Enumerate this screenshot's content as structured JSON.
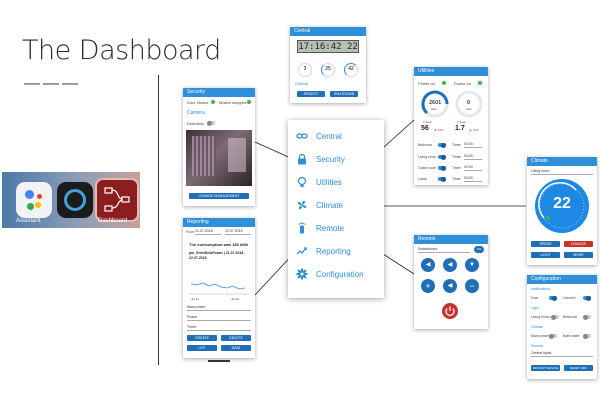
{
  "page": {
    "title": "The Dashboard",
    "dashes": "———"
  },
  "dock": {
    "apps": [
      {
        "label": "Assistant",
        "icon": "google-assistant-icon"
      },
      {
        "label": "",
        "icon": "alexa-ring-icon"
      },
      {
        "label": "Dashboard",
        "icon": "node-red-flow-icon"
      }
    ]
  },
  "menu": {
    "items": [
      {
        "label": "Central",
        "icon": "link-icon"
      },
      {
        "label": "Security",
        "icon": "lock-icon"
      },
      {
        "label": "Utilities",
        "icon": "lightbulb-icon"
      },
      {
        "label": "Climate",
        "icon": "fan-icon"
      },
      {
        "label": "Remote",
        "icon": "remote-icon"
      },
      {
        "label": "Reporting",
        "icon": "trending-icon"
      },
      {
        "label": "Configuration",
        "icon": "gear-icon"
      }
    ],
    "accent": "#2f8fd8"
  },
  "central": {
    "header": "Central",
    "clock": "17:16:42 22",
    "gauges": [
      "3",
      "25",
      "42"
    ],
    "link": "Central",
    "buttons": [
      "REBOOT",
      "SHUTDOWN"
    ]
  },
  "security": {
    "header": "Security",
    "door": "Door closed",
    "motion": "Motion stopped",
    "camera": "Camera",
    "detection": "Detection",
    "button": "CHANGE MANAGEMENT"
  },
  "utilities": {
    "header": "Utilities",
    "power_a": "Power on",
    "power_b": "Power on",
    "gauge_a": "2601",
    "gauge_a_unit": "watt",
    "gauge_b": "0",
    "gauge_b_unit": "watt",
    "days_a": "7 days",
    "val_a": "56",
    "pct_a": "▼ 32%",
    "days_b": "7 days",
    "val_b": "1.7",
    "pct_b": "▲ 18%",
    "rows": [
      {
        "label": "Bedroom",
        "timer": "Timer",
        "time": "00:00"
      },
      {
        "label": "Living room",
        "timer": "Timer",
        "time": "00:00"
      },
      {
        "label": "Guest room",
        "timer": "Timer",
        "time": "00:00"
      },
      {
        "label": "Lamp",
        "timer": "Timer",
        "time": "00:00"
      }
    ]
  },
  "reporting": {
    "header": "Reporting",
    "from_label": "From",
    "from": "21.07.2018",
    "to": "22.07.2018",
    "consumption": "The consumption was 180 kWh",
    "chart_title": "pm_EnerStickPower | 21.07.2018 - 22.07.2018",
    "axis": [
      "Jul 21",
      "Jul 22"
    ],
    "selects": [
      "Main power",
      "Phase",
      "Three"
    ],
    "buttons": [
      "CREATE",
      "DELETE",
      "LIST",
      "DATA"
    ]
  },
  "climate": {
    "header": "Climate",
    "room": "Living room",
    "temp": "22",
    "buttons": [
      "SPEED",
      "CHANGE",
      "LIGHT",
      "MORE"
    ]
  },
  "remote": {
    "header": "Remote",
    "select": "Switchboard",
    "toggle": "ON"
  },
  "config": {
    "header": "Configuration",
    "notif": "Notifications",
    "door": "Door",
    "camera": "Camera",
    "light": "Light",
    "living": "Living Room",
    "bedroom": "Bedroom",
    "climate": "Climate",
    "main": "Main power",
    "bath": "Bath water",
    "remote": "Remote",
    "central": "Central lights",
    "buttons": [
      "RESTART DEVICE",
      "RESET WIFI"
    ]
  }
}
